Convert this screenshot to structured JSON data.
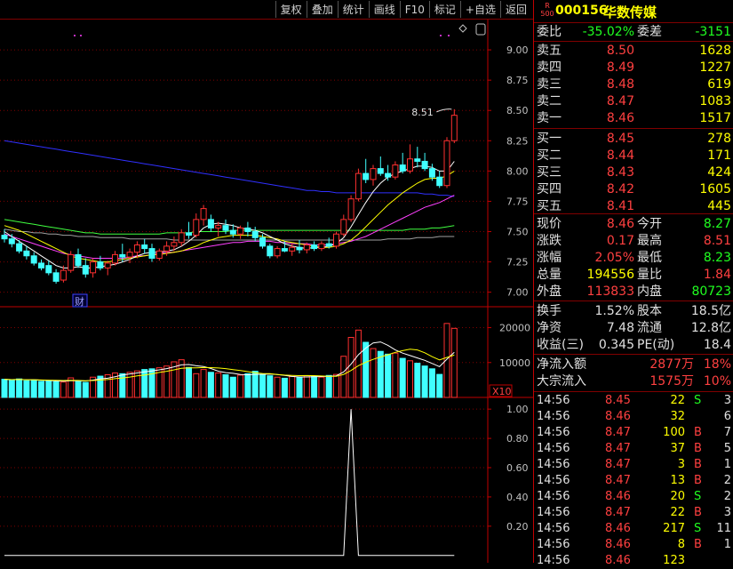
{
  "toolbar": [
    "复权",
    "叠加",
    "统计",
    "画线",
    "F10",
    "标记",
    "+自选",
    "返回"
  ],
  "stock": {
    "code": "000156",
    "name": "华数传媒",
    "logo_top": "R",
    "logo_bottom": "500"
  },
  "main_chart": {
    "y_ticks": [
      "9.00",
      "8.75",
      "8.50",
      "8.25",
      "8.00",
      "7.75",
      "7.50",
      "7.25",
      "7.00"
    ],
    "y_tick_values": [
      9.0,
      8.75,
      8.5,
      8.25,
      8.0,
      7.75,
      7.5,
      7.25,
      7.0
    ],
    "y_range": [
      6.88,
      9.25
    ],
    "high_annotation": "8.51",
    "marker_label": "财",
    "candles": [
      [
        7.47,
        7.52,
        7.41,
        7.44
      ],
      [
        7.44,
        7.48,
        7.37,
        7.4
      ],
      [
        7.4,
        7.43,
        7.32,
        7.34
      ],
      [
        7.34,
        7.38,
        7.27,
        7.3
      ],
      [
        7.3,
        7.33,
        7.22,
        7.24
      ],
      [
        7.24,
        7.27,
        7.18,
        7.2
      ],
      [
        7.22,
        7.26,
        7.14,
        7.16
      ],
      [
        7.16,
        7.19,
        7.07,
        7.09
      ],
      [
        7.1,
        7.22,
        7.08,
        7.18
      ],
      [
        7.18,
        7.34,
        7.16,
        7.31
      ],
      [
        7.31,
        7.36,
        7.2,
        7.22
      ],
      [
        7.22,
        7.28,
        7.12,
        7.15
      ],
      [
        7.16,
        7.28,
        7.12,
        7.25
      ],
      [
        7.25,
        7.3,
        7.18,
        7.2
      ],
      [
        7.2,
        7.26,
        7.14,
        7.24
      ],
      [
        7.24,
        7.34,
        7.22,
        7.31
      ],
      [
        7.31,
        7.4,
        7.25,
        7.29
      ],
      [
        7.29,
        7.36,
        7.24,
        7.33
      ],
      [
        7.33,
        7.42,
        7.28,
        7.39
      ],
      [
        7.39,
        7.44,
        7.32,
        7.36
      ],
      [
        7.36,
        7.4,
        7.25,
        7.28
      ],
      [
        7.28,
        7.36,
        7.26,
        7.34
      ],
      [
        7.34,
        7.42,
        7.3,
        7.38
      ],
      [
        7.38,
        7.46,
        7.34,
        7.41
      ],
      [
        7.41,
        7.52,
        7.38,
        7.49
      ],
      [
        7.49,
        7.58,
        7.44,
        7.47
      ],
      [
        7.47,
        7.65,
        7.45,
        7.6
      ],
      [
        7.6,
        7.72,
        7.55,
        7.69
      ],
      [
        7.6,
        7.64,
        7.5,
        7.53
      ],
      [
        7.53,
        7.58,
        7.46,
        7.55
      ],
      [
        7.55,
        7.6,
        7.48,
        7.51
      ],
      [
        7.51,
        7.56,
        7.45,
        7.48
      ],
      [
        7.48,
        7.55,
        7.44,
        7.53
      ],
      [
        7.53,
        7.58,
        7.46,
        7.5
      ],
      [
        7.5,
        7.54,
        7.42,
        7.45
      ],
      [
        7.45,
        7.48,
        7.36,
        7.38
      ],
      [
        7.38,
        7.4,
        7.28,
        7.3
      ],
      [
        7.3,
        7.38,
        7.28,
        7.36
      ],
      [
        7.36,
        7.42,
        7.33,
        7.34
      ],
      [
        7.34,
        7.4,
        7.3,
        7.37
      ],
      [
        7.37,
        7.43,
        7.32,
        7.35
      ],
      [
        7.35,
        7.41,
        7.32,
        7.39
      ],
      [
        7.39,
        7.42,
        7.34,
        7.36
      ],
      [
        7.36,
        7.42,
        7.34,
        7.4
      ],
      [
        7.4,
        7.45,
        7.36,
        7.38
      ],
      [
        7.38,
        7.5,
        7.36,
        7.48
      ],
      [
        7.48,
        7.64,
        7.46,
        7.6
      ],
      [
        7.6,
        7.8,
        7.58,
        7.77
      ],
      [
        7.77,
        8.02,
        7.75,
        7.98
      ],
      [
        7.98,
        8.1,
        7.9,
        7.93
      ],
      [
        7.93,
        8.05,
        7.88,
        8.02
      ],
      [
        8.02,
        8.12,
        7.96,
        7.98
      ],
      [
        7.98,
        8.05,
        7.92,
        7.95
      ],
      [
        7.95,
        8.08,
        7.93,
        8.05
      ],
      [
        8.05,
        8.15,
        7.98,
        8.0
      ],
      [
        8.0,
        8.22,
        7.98,
        8.1
      ],
      [
        8.1,
        8.2,
        8.03,
        8.08
      ],
      [
        8.08,
        8.15,
        8.0,
        8.02
      ],
      [
        8.02,
        8.06,
        7.92,
        7.95
      ],
      [
        7.95,
        8.0,
        7.86,
        7.88
      ],
      [
        7.88,
        8.28,
        7.86,
        8.25
      ],
      [
        8.25,
        8.51,
        8.23,
        8.46
      ]
    ],
    "ma_white": [
      7.5,
      7.46,
      7.42,
      7.38,
      7.34,
      7.3,
      7.26,
      7.22,
      7.2,
      7.2,
      7.21,
      7.2,
      7.2,
      7.21,
      7.22,
      7.23,
      7.25,
      7.27,
      7.3,
      7.32,
      7.33,
      7.33,
      7.34,
      7.35,
      7.38,
      7.42,
      7.47,
      7.53,
      7.56,
      7.57,
      7.56,
      7.55,
      7.53,
      7.52,
      7.51,
      7.49,
      7.46,
      7.43,
      7.4,
      7.38,
      7.37,
      7.36,
      7.37,
      7.37,
      7.38,
      7.4,
      7.45,
      7.54,
      7.64,
      7.74,
      7.83,
      7.9,
      7.95,
      7.98,
      8.0,
      8.02,
      8.04,
      8.04,
      8.03,
      8.0,
      8.0,
      8.08
    ],
    "ma_yellow": [
      7.55,
      7.53,
      7.51,
      7.48,
      7.45,
      7.42,
      7.39,
      7.36,
      7.33,
      7.3,
      7.28,
      7.27,
      7.26,
      7.25,
      7.25,
      7.26,
      7.27,
      7.28,
      7.29,
      7.3,
      7.31,
      7.31,
      7.32,
      7.33,
      7.34,
      7.36,
      7.38,
      7.41,
      7.43,
      7.45,
      7.46,
      7.47,
      7.47,
      7.47,
      7.47,
      7.46,
      7.45,
      7.44,
      7.42,
      7.41,
      7.4,
      7.39,
      7.38,
      7.37,
      7.37,
      7.38,
      7.4,
      7.43,
      7.48,
      7.54,
      7.6,
      7.66,
      7.72,
      7.77,
      7.82,
      7.86,
      7.9,
      7.93,
      7.94,
      7.94,
      7.96,
      8.0
    ],
    "ma_magenta": [
      7.48,
      7.46,
      7.44,
      7.42,
      7.4,
      7.38,
      7.36,
      7.34,
      7.32,
      7.31,
      7.3,
      7.29,
      7.28,
      7.28,
      7.28,
      7.28,
      7.28,
      7.29,
      7.3,
      7.3,
      7.31,
      7.32,
      7.33,
      7.33,
      7.34,
      7.35,
      7.36,
      7.37,
      7.38,
      7.39,
      7.4,
      7.41,
      7.41,
      7.42,
      7.42,
      7.42,
      7.42,
      7.41,
      7.41,
      7.4,
      7.4,
      7.4,
      7.39,
      7.39,
      7.39,
      7.4,
      7.41,
      7.42,
      7.44,
      7.46,
      7.49,
      7.52,
      7.55,
      7.58,
      7.61,
      7.64,
      7.67,
      7.7,
      7.72,
      7.74,
      7.77,
      7.8
    ],
    "ma_green": [
      7.6,
      7.59,
      7.58,
      7.57,
      7.56,
      7.55,
      7.54,
      7.53,
      7.52,
      7.51,
      7.5,
      7.49,
      7.49,
      7.48,
      7.48,
      7.48,
      7.48,
      7.48,
      7.48,
      7.48,
      7.48,
      7.48,
      7.49,
      7.49,
      7.49,
      7.49,
      7.5,
      7.5,
      7.5,
      7.5,
      7.5,
      7.51,
      7.51,
      7.51,
      7.51,
      7.51,
      7.51,
      7.51,
      7.51,
      7.51,
      7.51,
      7.51,
      7.51,
      7.51,
      7.51,
      7.51,
      7.51,
      7.51,
      7.51,
      7.51,
      7.51,
      7.51,
      7.51,
      7.51,
      7.51,
      7.52,
      7.52,
      7.52,
      7.53,
      7.53,
      7.54,
      7.55
    ],
    "ma_gray": [
      7.52,
      7.51,
      7.5,
      7.5,
      7.49,
      7.49,
      7.48,
      7.48,
      7.47,
      7.47,
      7.46,
      7.46,
      7.46,
      7.45,
      7.45,
      7.45,
      7.45,
      7.44,
      7.44,
      7.44,
      7.44,
      7.44,
      7.44,
      7.43,
      7.43,
      7.43,
      7.43,
      7.43,
      7.43,
      7.43,
      7.43,
      7.43,
      7.43,
      7.43,
      7.43,
      7.43,
      7.43,
      7.43,
      7.43,
      7.43,
      7.43,
      7.43,
      7.43,
      7.43,
      7.43,
      7.43,
      7.43,
      7.43,
      7.43,
      7.43,
      7.43,
      7.43,
      7.44,
      7.44,
      7.44,
      7.44,
      7.45,
      7.45,
      7.45,
      7.46,
      7.46,
      7.46
    ],
    "ma_blue": [
      8.25,
      8.24,
      8.23,
      8.22,
      8.21,
      8.2,
      8.19,
      8.18,
      8.17,
      8.16,
      8.15,
      8.14,
      8.13,
      8.12,
      8.11,
      8.1,
      8.09,
      8.08,
      8.07,
      8.06,
      8.05,
      8.04,
      8.03,
      8.02,
      8.01,
      8.0,
      7.99,
      7.98,
      7.97,
      7.96,
      7.95,
      7.94,
      7.93,
      7.92,
      7.91,
      7.9,
      7.89,
      7.88,
      7.87,
      7.86,
      7.85,
      7.84,
      7.84,
      7.83,
      7.83,
      7.82,
      7.82,
      7.82,
      7.82,
      7.82,
      7.82,
      7.82,
      7.82,
      7.82,
      7.82,
      7.82,
      7.82,
      7.81,
      7.81,
      7.8,
      7.8,
      7.79
    ]
  },
  "volume_chart": {
    "y_ticks": [
      "20000",
      "10000"
    ],
    "y_tick_values": [
      20000,
      10000
    ],
    "y_max": 26000,
    "unit": "X10",
    "volumes": [
      5200,
      5000,
      5300,
      4800,
      5000,
      4600,
      4700,
      4500,
      4400,
      5600,
      4800,
      4300,
      5800,
      6100,
      6500,
      7000,
      6800,
      7200,
      7600,
      8000,
      8200,
      8500,
      9000,
      10200,
      10800,
      8600,
      6800,
      8000,
      7200,
      7000,
      6500,
      5800,
      6400,
      6800,
      7500,
      6600,
      6200,
      5800,
      5500,
      6000,
      5800,
      6200,
      6100,
      5800,
      6300,
      6600,
      11800,
      17200,
      19300,
      15800,
      14000,
      13200,
      12400,
      12700,
      11200,
      10500,
      9800,
      9000,
      8200,
      6600,
      21200,
      19800
    ]
  },
  "indicator_chart": {
    "y_ticks": [
      "1.00",
      "0.80",
      "0.60",
      "0.40",
      "0.20"
    ],
    "y_tick_values": [
      1.0,
      0.8,
      0.6,
      0.4,
      0.2
    ],
    "y_range": [
      -0.05,
      1.08
    ],
    "values": [
      0,
      0,
      0,
      0,
      0,
      0,
      0,
      0,
      0,
      0,
      0,
      0,
      0,
      0,
      0,
      0,
      0,
      0,
      0,
      0,
      0,
      0,
      0,
      0,
      0,
      0,
      0,
      0,
      0,
      0,
      0,
      0,
      0,
      0,
      0,
      0,
      0,
      0,
      0,
      0,
      0,
      0,
      0,
      0,
      0,
      0,
      0,
      1,
      0,
      0,
      0,
      0,
      0,
      0,
      0,
      0,
      0,
      0,
      0,
      0,
      0,
      0
    ]
  },
  "quote": {
    "weibi_label": "委比",
    "weibi": "-35.02%",
    "weicha_label": "委差",
    "weicha": "-3151",
    "asks": [
      [
        "卖五",
        "8.50",
        "1628"
      ],
      [
        "卖四",
        "8.49",
        "1227"
      ],
      [
        "卖三",
        "8.48",
        "619"
      ],
      [
        "卖二",
        "8.47",
        "1083"
      ],
      [
        "卖一",
        "8.46",
        "1517"
      ]
    ],
    "bids": [
      [
        "买一",
        "8.45",
        "278"
      ],
      [
        "买二",
        "8.44",
        "171"
      ],
      [
        "买三",
        "8.43",
        "424"
      ],
      [
        "买四",
        "8.42",
        "1605"
      ],
      [
        "买五",
        "8.41",
        "445"
      ]
    ],
    "stats": [
      [
        "现价",
        "8.46",
        "今开",
        "8.27"
      ],
      [
        "涨跌",
        "0.17",
        "最高",
        "8.51"
      ],
      [
        "涨幅",
        "2.05%",
        "最低",
        "8.23"
      ],
      [
        "总量",
        "194556",
        "量比",
        "1.84"
      ],
      [
        "外盘",
        "113833",
        "内盘",
        "80723"
      ]
    ],
    "extra": [
      [
        "换手",
        "1.52%",
        "股本",
        "18.5亿"
      ],
      [
        "净资",
        "7.48",
        "流通",
        "12.8亿"
      ],
      [
        "收益(三)",
        "0.345",
        "PE(动)",
        "18.4"
      ]
    ],
    "flows": [
      [
        "净流入额",
        "2877万",
        "18%"
      ],
      [
        "大宗流入",
        "1575万",
        "10%"
      ]
    ],
    "trades": [
      [
        "14:56",
        "8.45",
        "22",
        "S",
        "3"
      ],
      [
        "14:56",
        "8.46",
        "32",
        "",
        "6"
      ],
      [
        "14:56",
        "8.47",
        "100",
        "B",
        "7"
      ],
      [
        "14:56",
        "8.47",
        "37",
        "B",
        "5"
      ],
      [
        "14:56",
        "8.47",
        "3",
        "B",
        "1"
      ],
      [
        "14:56",
        "8.47",
        "13",
        "B",
        "2"
      ],
      [
        "14:56",
        "8.46",
        "20",
        "S",
        "2"
      ],
      [
        "14:56",
        "8.47",
        "22",
        "B",
        "3"
      ],
      [
        "14:56",
        "8.46",
        "217",
        "S",
        "11"
      ],
      [
        "14:56",
        "8.46",
        "8",
        "B",
        "1"
      ],
      [
        "14:56",
        "8.46",
        "123",
        "",
        ""
      ]
    ]
  },
  "colors": {
    "up": "#ff3030",
    "down": "#40ffff",
    "grid": "#800000",
    "axis": "#c00000"
  }
}
